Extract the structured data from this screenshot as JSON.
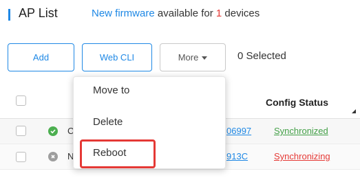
{
  "header": {
    "title": "AP List",
    "notice_link": "New firmware",
    "notice_middle": " available for ",
    "notice_count": "1",
    "notice_end": " devices"
  },
  "toolbar": {
    "add_label": "Add",
    "webcli_label": "Web CLI",
    "more_label": "More",
    "selected_label": "0 Selected"
  },
  "table": {
    "columns": {
      "config_status": "Config Status"
    },
    "rows": [
      {
        "name_initial": "C",
        "sn_suffix": "06997",
        "config_status": "Synchronized",
        "status": "online"
      },
      {
        "name_initial": "N",
        "sn_suffix": "913C",
        "config_status": "Synchronizing",
        "status": "offline"
      }
    ]
  },
  "more_menu": {
    "items": [
      "Move to",
      "Delete",
      "Reboot"
    ],
    "highlighted": "Reboot"
  },
  "colors": {
    "accent": "#1e88e5",
    "online": "#4caf50",
    "offline": "#9e9e9e",
    "error": "#e53935"
  }
}
